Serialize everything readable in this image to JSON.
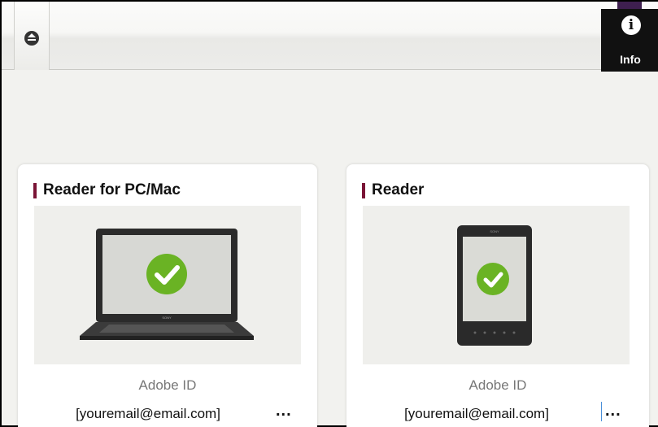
{
  "toolbar": {
    "eject_icon": "eject-icon",
    "info_icon": "info-icon",
    "info_label": "Info"
  },
  "devices": [
    {
      "title": "Reader for PC/Mac",
      "image": "laptop-checked",
      "status_icon": "check-icon",
      "id_label": "Adobe ID",
      "email": "[youremail@email.com]",
      "more_label": "..."
    },
    {
      "title": "Reader",
      "image": "ereader-checked",
      "status_icon": "check-icon",
      "id_label": "Adobe ID",
      "email": "[youremail@email.com]",
      "more_label": "..."
    }
  ],
  "colors": {
    "accent": "#7a1436",
    "check": "#6ab324",
    "info_bg": "#111111"
  }
}
